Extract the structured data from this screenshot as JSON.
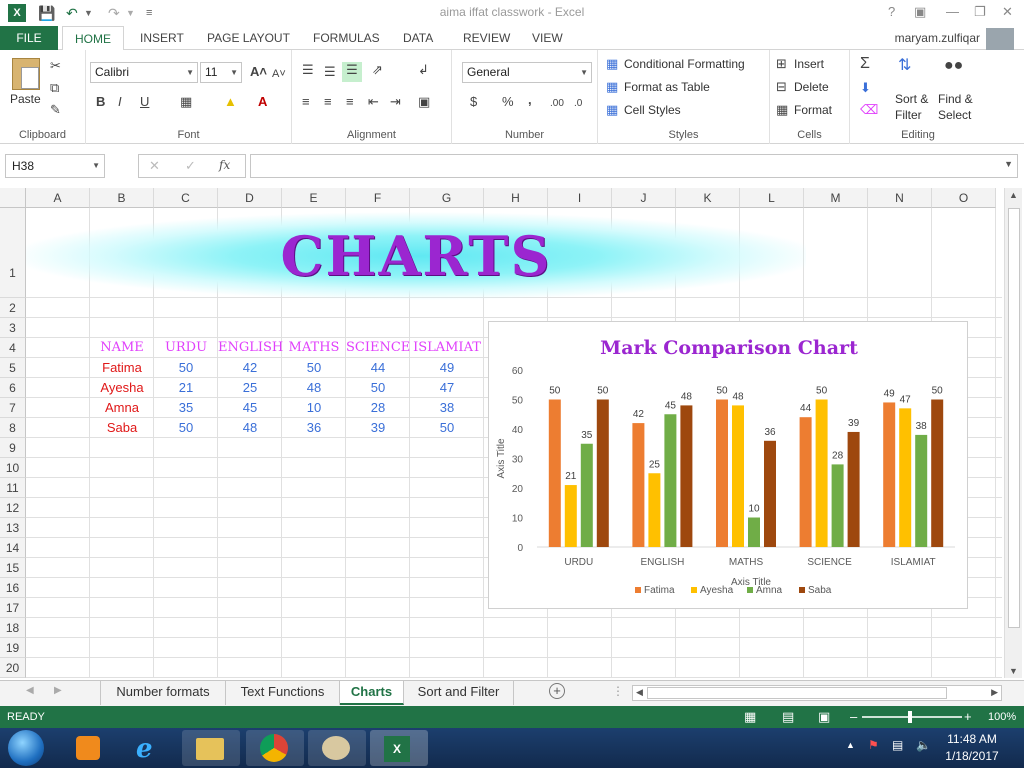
{
  "window": {
    "title": "aima iffat classwork - Excel",
    "app_icon_label": "X"
  },
  "ribbon": {
    "tabs": [
      "FILE",
      "HOME",
      "INSERT",
      "PAGE LAYOUT",
      "FORMULAS",
      "DATA",
      "REVIEW",
      "VIEW"
    ],
    "active_tab": "HOME",
    "user": "maryam.zulfiqar",
    "clipboard": {
      "paste": "Paste",
      "label": "Clipboard"
    },
    "font": {
      "name": "Calibri",
      "size": "11",
      "label": "Font",
      "bold": "B",
      "italic": "I",
      "underline": "U"
    },
    "alignment": {
      "label": "Alignment"
    },
    "number": {
      "format": "General",
      "label": "Number",
      "currency": "$",
      "percent": "%",
      "comma": ",",
      "inc_decimal": ".00",
      "dec_decimal": ".0"
    },
    "styles": {
      "conditional": "Conditional Formatting",
      "table": "Format as Table",
      "cell_styles": "Cell Styles",
      "label": "Styles"
    },
    "cells": {
      "insert": "Insert",
      "delete": "Delete",
      "format": "Format",
      "label": "Cells"
    },
    "editing": {
      "sort": "Sort &",
      "sort2": "Filter",
      "find": "Find &",
      "find2": "Select",
      "label": "Editing"
    }
  },
  "formula_bar": {
    "name_box": "H38",
    "fx": "fx",
    "value": ""
  },
  "columns": [
    "A",
    "B",
    "C",
    "D",
    "E",
    "F",
    "G",
    "H",
    "I",
    "J",
    "K",
    "L",
    "M",
    "N",
    "O"
  ],
  "rows": [
    "1",
    "2",
    "3",
    "4",
    "5",
    "6",
    "7",
    "8",
    "9",
    "10",
    "11",
    "12",
    "13",
    "14",
    "15",
    "16",
    "17",
    "18",
    "19",
    "20"
  ],
  "sheet": {
    "banner_title": "CHARTS",
    "headers": [
      "NAME",
      "URDU",
      "ENGLISH",
      "MATHS",
      "SCIENCE",
      "ISLAMIAT"
    ],
    "rows": [
      {
        "name": "Fatima",
        "values": [
          "50",
          "42",
          "50",
          "44",
          "49"
        ]
      },
      {
        "name": "Ayesha",
        "values": [
          "21",
          "25",
          "48",
          "50",
          "47"
        ]
      },
      {
        "name": "Amna",
        "values": [
          "35",
          "45",
          "10",
          "28",
          "38"
        ]
      },
      {
        "name": "Saba",
        "values": [
          "50",
          "48",
          "36",
          "39",
          "50"
        ]
      }
    ]
  },
  "chart_data": {
    "type": "bar",
    "title": "Mark Comparison Chart",
    "xlabel": "Axis Title",
    "ylabel": "Axis Title",
    "categories": [
      "URDU",
      "ENGLISH",
      "MATHS",
      "SCIENCE",
      "ISLAMIAT"
    ],
    "ylim": [
      0,
      60
    ],
    "yticks": [
      0,
      10,
      20,
      30,
      40,
      50,
      60
    ],
    "grid": false,
    "legend": "bottom",
    "series": [
      {
        "name": "Fatima",
        "color": "#ed7d31",
        "values": [
          50,
          42,
          50,
          44,
          49
        ]
      },
      {
        "name": "Ayesha",
        "color": "#ffc000",
        "values": [
          21,
          25,
          48,
          50,
          47
        ]
      },
      {
        "name": "Amna",
        "color": "#70ad47",
        "values": [
          35,
          45,
          10,
          28,
          38
        ]
      },
      {
        "name": "Saba",
        "color": "#9e480e",
        "values": [
          50,
          48,
          36,
          39,
          50
        ]
      }
    ]
  },
  "sheet_tabs": [
    "Number formats",
    "Text Functions",
    "Charts",
    "Sort and Filter"
  ],
  "active_sheet": "Charts",
  "status": {
    "mode": "READY",
    "zoom": "100%"
  },
  "taskbar": {
    "time": "11:48 AM",
    "date": "1/18/2017"
  },
  "colors": {
    "excel_green": "#217346",
    "title_purple": "#9b26d0",
    "header_magenta": "#e040fb",
    "name_red": "#e01818",
    "value_blue": "#3a6fd8"
  }
}
